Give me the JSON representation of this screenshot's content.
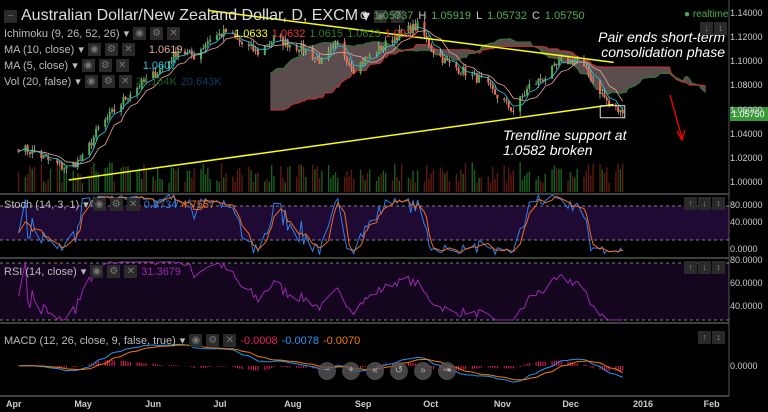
{
  "header": {
    "title": "Australian Dollar/New Zealand Dollar, D, EXCM",
    "ohlc": {
      "o_label": "O",
      "o": "1.05737",
      "h_label": "H",
      "h": "1.05919",
      "l_label": "L",
      "l": "1.05732",
      "c_label": "C",
      "c": "1.05750"
    },
    "realtime": "realtime"
  },
  "legends": {
    "ichimoku": {
      "label": "Ichimoku (9, 26, 52, 26)",
      "values": [
        "1.0633",
        "1.0632",
        "1.0615",
        "1.0823",
        "1.0922"
      ]
    },
    "ma10": {
      "label": "MA (10, close)",
      "value": "1.0619"
    },
    "ma5": {
      "label": "MA (5, close)",
      "value": "1.0607"
    },
    "vol": {
      "label": "Vol (20, false)",
      "values": [
        "22.164K",
        "20.643K"
      ]
    },
    "stoch": {
      "label": "Stoch (14, 3, 1)",
      "values": [
        "0.8734",
        "4.7557"
      ]
    },
    "rsi": {
      "label": "RSI (14, close)",
      "value": "31.3679"
    },
    "macd": {
      "label": "MACD (12, 26, close, 9, false, true)",
      "values": [
        "-0.0008",
        "-0.0078",
        "-0.0070"
      ]
    }
  },
  "annotations": {
    "top": "Pair ends short-term consolidation phase",
    "bottom": "Trendline support at 1.0582 broken"
  },
  "colors": {
    "up": "#4caf50",
    "down": "#f26b4f",
    "trendline": "#ffff00",
    "arrow": "#ff0000",
    "cloud": "#6b5b5b",
    "stoch_k": "#2f80ed",
    "stoch_d": "#f26b1d",
    "rsi": "#9c27b0",
    "macd": "#2196f3",
    "signal": "#f57c00",
    "hist": "#e91e63"
  },
  "chart_data": {
    "type": "candlestick",
    "symbol": "AUD/NZD",
    "interval": "D",
    "weekly_closes": [
      [
        "2015-04-03",
        1.03
      ],
      [
        "2015-04-10",
        1.025
      ],
      [
        "2015-04-17",
        1.018
      ],
      [
        "2015-04-24",
        1.012
      ],
      [
        "2015-05-01",
        1.02
      ],
      [
        "2015-05-08",
        1.045
      ],
      [
        "2015-05-15",
        1.06
      ],
      [
        "2015-05-22",
        1.075
      ],
      [
        "2015-05-29",
        1.085
      ],
      [
        "2015-06-05",
        1.095
      ],
      [
        "2015-06-12",
        1.11
      ],
      [
        "2015-06-19",
        1.105
      ],
      [
        "2015-06-26",
        1.12
      ],
      [
        "2015-07-03",
        1.125
      ],
      [
        "2015-07-10",
        1.115
      ],
      [
        "2015-07-17",
        1.108
      ],
      [
        "2015-07-24",
        1.12
      ],
      [
        "2015-07-31",
        1.115
      ],
      [
        "2015-08-07",
        1.11
      ],
      [
        "2015-08-14",
        1.1
      ],
      [
        "2015-08-21",
        1.115
      ],
      [
        "2015-08-28",
        1.095
      ],
      [
        "2015-09-04",
        1.105
      ],
      [
        "2015-09-11",
        1.115
      ],
      [
        "2015-09-18",
        1.125
      ],
      [
        "2015-09-25",
        1.13
      ],
      [
        "2015-10-02",
        1.11
      ],
      [
        "2015-10-09",
        1.098
      ],
      [
        "2015-10-16",
        1.092
      ],
      [
        "2015-10-23",
        1.085
      ],
      [
        "2015-10-30",
        1.072
      ],
      [
        "2015-11-06",
        1.06
      ],
      [
        "2015-11-13",
        1.08
      ],
      [
        "2015-11-20",
        1.088
      ],
      [
        "2015-11-27",
        1.1
      ],
      [
        "2015-12-04",
        1.102
      ],
      [
        "2015-12-11",
        1.085
      ],
      [
        "2015-12-18",
        1.065
      ],
      [
        "2015-12-24",
        1.0575
      ]
    ],
    "last_price": "1.05750",
    "trendlines": [
      {
        "from": [
          "2015-06-25",
          1.143
        ],
        "to": [
          "2015-12-20",
          1.0999
        ]
      },
      {
        "from": [
          "2015-04-25",
          1.0025
        ],
        "to": [
          "2015-12-20",
          1.065
        ]
      }
    ],
    "price_ticks": [
      "1.14000",
      "1.12000",
      "1.10000",
      "1.08000",
      "1.06000",
      "1.04000",
      "1.02000",
      "1.00000"
    ],
    "ylim": [
      0.995,
      1.145
    ],
    "time_ticks": [
      "Apr",
      "May",
      "Jun",
      "Jul",
      "Aug",
      "Sep",
      "Oct",
      "Nov",
      "Dec",
      "2016",
      "Feb"
    ],
    "stoch_ticks": [
      "80.0000",
      "40.0000",
      "0.0000"
    ],
    "rsi_ticks": [
      "80.0000",
      "60.0000",
      "40.0000"
    ],
    "macd_ticks": [
      "0.0000"
    ]
  }
}
